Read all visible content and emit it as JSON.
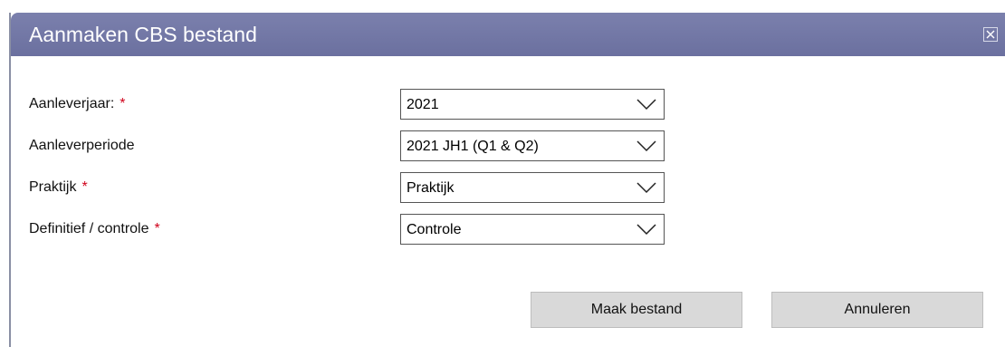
{
  "dialog": {
    "title": "Aanmaken CBS bestand",
    "close_icon": "close-icon"
  },
  "form": {
    "fields": [
      {
        "label": "Aanleverjaar:",
        "required_mark": "*",
        "value": "2021"
      },
      {
        "label": "Aanleverperiode",
        "required_mark": "",
        "value": "2021 JH1 (Q1 & Q2)"
      },
      {
        "label": "Praktijk",
        "required_mark": "*",
        "value": "Praktijk"
      },
      {
        "label": "Definitief / controle",
        "required_mark": "*",
        "value": "Controle"
      }
    ]
  },
  "buttons": {
    "create_label": "Maak bestand",
    "cancel_label": "Annuleren"
  },
  "colors": {
    "titlebar": "#6f74a3",
    "required": "#d0021b",
    "button_bg": "#d9d9d9"
  }
}
